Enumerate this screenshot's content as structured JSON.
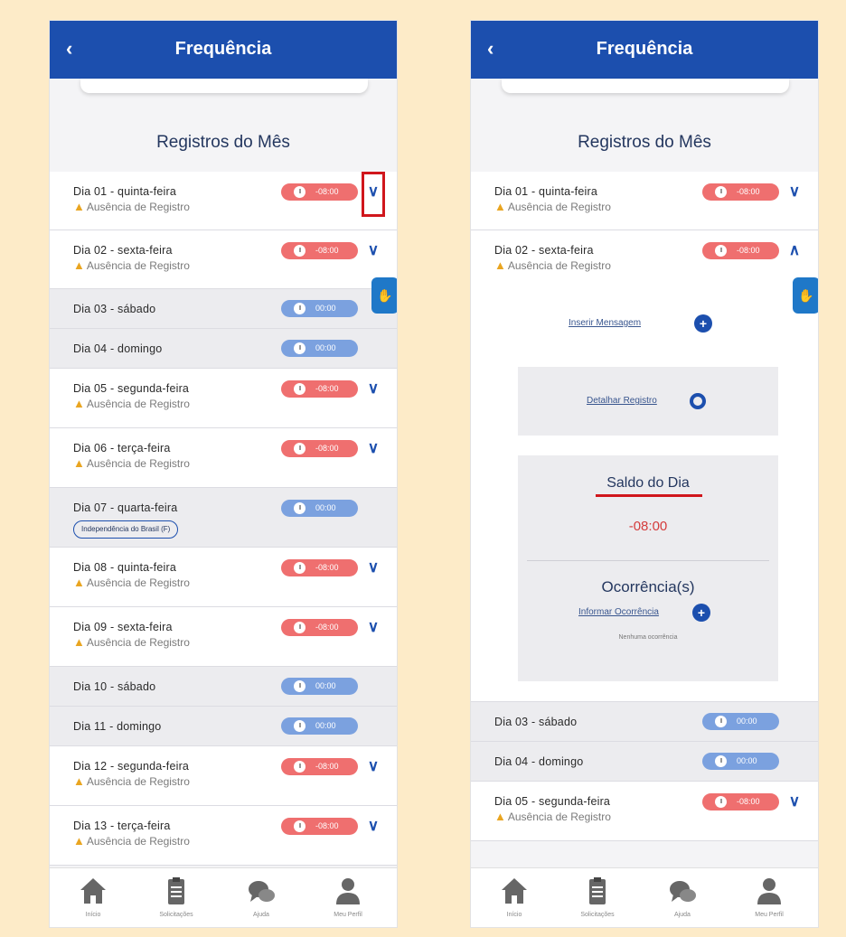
{
  "app": {
    "title": "Frequência",
    "back_glyph": "‹",
    "section_title": "Registros do Mês",
    "float_icon": "✋"
  },
  "colors": {
    "brand": "#1c4fae",
    "negative_badge": "#ef6f6f",
    "neutral_badge": "#7ba1df",
    "warning": "#e9a521",
    "highlight": "#d0161c"
  },
  "left_list": [
    {
      "day": "Dia 01 - quinta-feira",
      "status": "Ausência de Registro",
      "badge": "-08:00"
    },
    {
      "day": "Dia 02 - sexta-feira",
      "status": "Ausência de Registro",
      "badge": "-08:00"
    },
    {
      "day": "Dia 03 - sábado",
      "badge": "00:00"
    },
    {
      "day": "Dia 04 - domingo",
      "badge": "00:00"
    },
    {
      "day": "Dia 05 - segunda-feira",
      "status": "Ausência de Registro",
      "badge": "-08:00"
    },
    {
      "day": "Dia 06 - terça-feira",
      "status": "Ausência de Registro",
      "badge": "-08:00"
    },
    {
      "day": "Dia 07 - quarta-feira",
      "holiday": "Independência do Brasil (F)",
      "badge": "00:00"
    },
    {
      "day": "Dia 08 - quinta-feira",
      "status": "Ausência de Registro",
      "badge": "-08:00"
    },
    {
      "day": "Dia 09 - sexta-feira",
      "status": "Ausência de Registro",
      "badge": "-08:00"
    },
    {
      "day": "Dia 10 - sábado",
      "badge": "00:00"
    },
    {
      "day": "Dia 11 - domingo",
      "badge": "00:00"
    },
    {
      "day": "Dia 12 - segunda-feira",
      "status": "Ausência de Registro",
      "badge": "-08:00"
    },
    {
      "day": "Dia 13 - terça-feira",
      "status": "Ausência de Registro",
      "badge": "-08:00"
    }
  ],
  "right_list": {
    "before": [
      {
        "day": "Dia 01 - quinta-feira",
        "status": "Ausência de Registro",
        "badge": "-08:00"
      },
      {
        "day": "Dia 02 - sexta-feira",
        "status": "Ausência de Registro",
        "badge": "-08:00"
      }
    ],
    "after": [
      {
        "day": "Dia 03 - sábado",
        "badge": "00:00"
      },
      {
        "day": "Dia 04 - domingo",
        "badge": "00:00"
      },
      {
        "day": "Dia 05 - segunda-feira",
        "status": "Ausência de Registro",
        "badge": "-08:00"
      }
    ]
  },
  "expanded": {
    "inserir_mensagem": "Inserir Mensagem",
    "detalhar_registro": "Detalhar Registro",
    "saldo_title": "Saldo do Dia",
    "saldo_value": "-08:00",
    "ocorrencias_title": "Ocorrência(s)",
    "informar_ocorrencia": "Informar Ocorrência",
    "nenhuma": "Nenhuma ocorrência",
    "plus_glyph": "+"
  },
  "chevrons": {
    "down": "∨",
    "up": "∧"
  },
  "nav": [
    {
      "label": "Início",
      "icon": "home-icon"
    },
    {
      "label": "Solicitações",
      "icon": "clipboard-icon"
    },
    {
      "label": "Ajuda",
      "icon": "chat-icon"
    },
    {
      "label": "Meu Perfil",
      "icon": "user-icon"
    }
  ]
}
